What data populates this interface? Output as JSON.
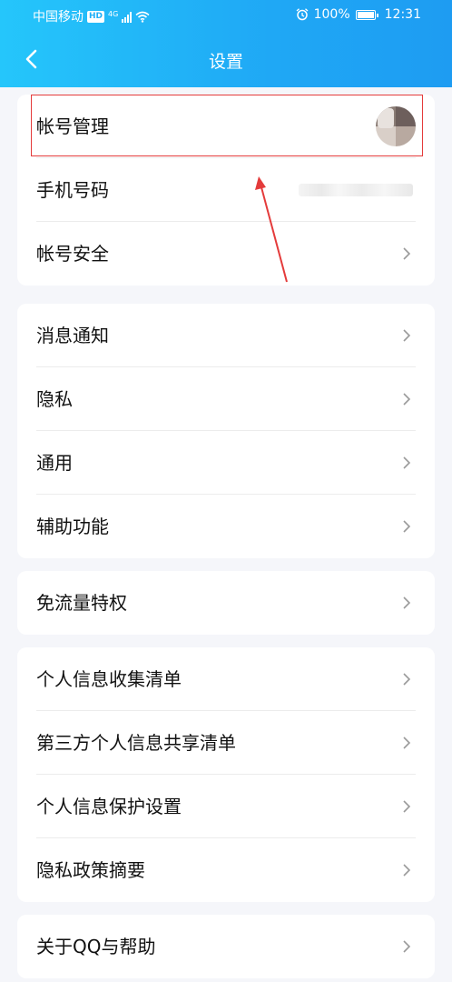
{
  "status_bar": {
    "carrier": "中国移动",
    "hd": "HD",
    "network": "4G",
    "battery": "100%",
    "time": "12:31",
    "icons": [
      "hd-icon",
      "signal-icon",
      "wifi-icon",
      "alarm-icon",
      "battery-icon"
    ]
  },
  "header": {
    "title": "设置",
    "back_icon": "chevron-left-icon"
  },
  "colors": {
    "header_start": "#25c6fb",
    "header_end": "#1e9cf2",
    "highlight": "#e43b3b",
    "background": "#f5f6fa"
  },
  "groups": [
    {
      "items": [
        {
          "label": "帐号管理",
          "trailing": "avatar"
        },
        {
          "label": "手机号码",
          "trailing": "blurred-phone"
        },
        {
          "label": "帐号安全",
          "trailing": "chevron"
        }
      ]
    },
    {
      "items": [
        {
          "label": "消息通知",
          "trailing": "chevron"
        },
        {
          "label": "隐私",
          "trailing": "chevron"
        },
        {
          "label": "通用",
          "trailing": "chevron"
        },
        {
          "label": "辅助功能",
          "trailing": "chevron"
        }
      ]
    },
    {
      "items": [
        {
          "label": "免流量特权",
          "trailing": "chevron"
        }
      ]
    },
    {
      "items": [
        {
          "label": "个人信息收集清单",
          "trailing": "chevron"
        },
        {
          "label": "第三方个人信息共享清单",
          "trailing": "chevron"
        },
        {
          "label": "个人信息保护设置",
          "trailing": "chevron"
        },
        {
          "label": "隐私政策摘要",
          "trailing": "chevron"
        }
      ]
    },
    {
      "items": [
        {
          "label": "关于QQ与帮助",
          "trailing": "chevron"
        }
      ]
    }
  ]
}
